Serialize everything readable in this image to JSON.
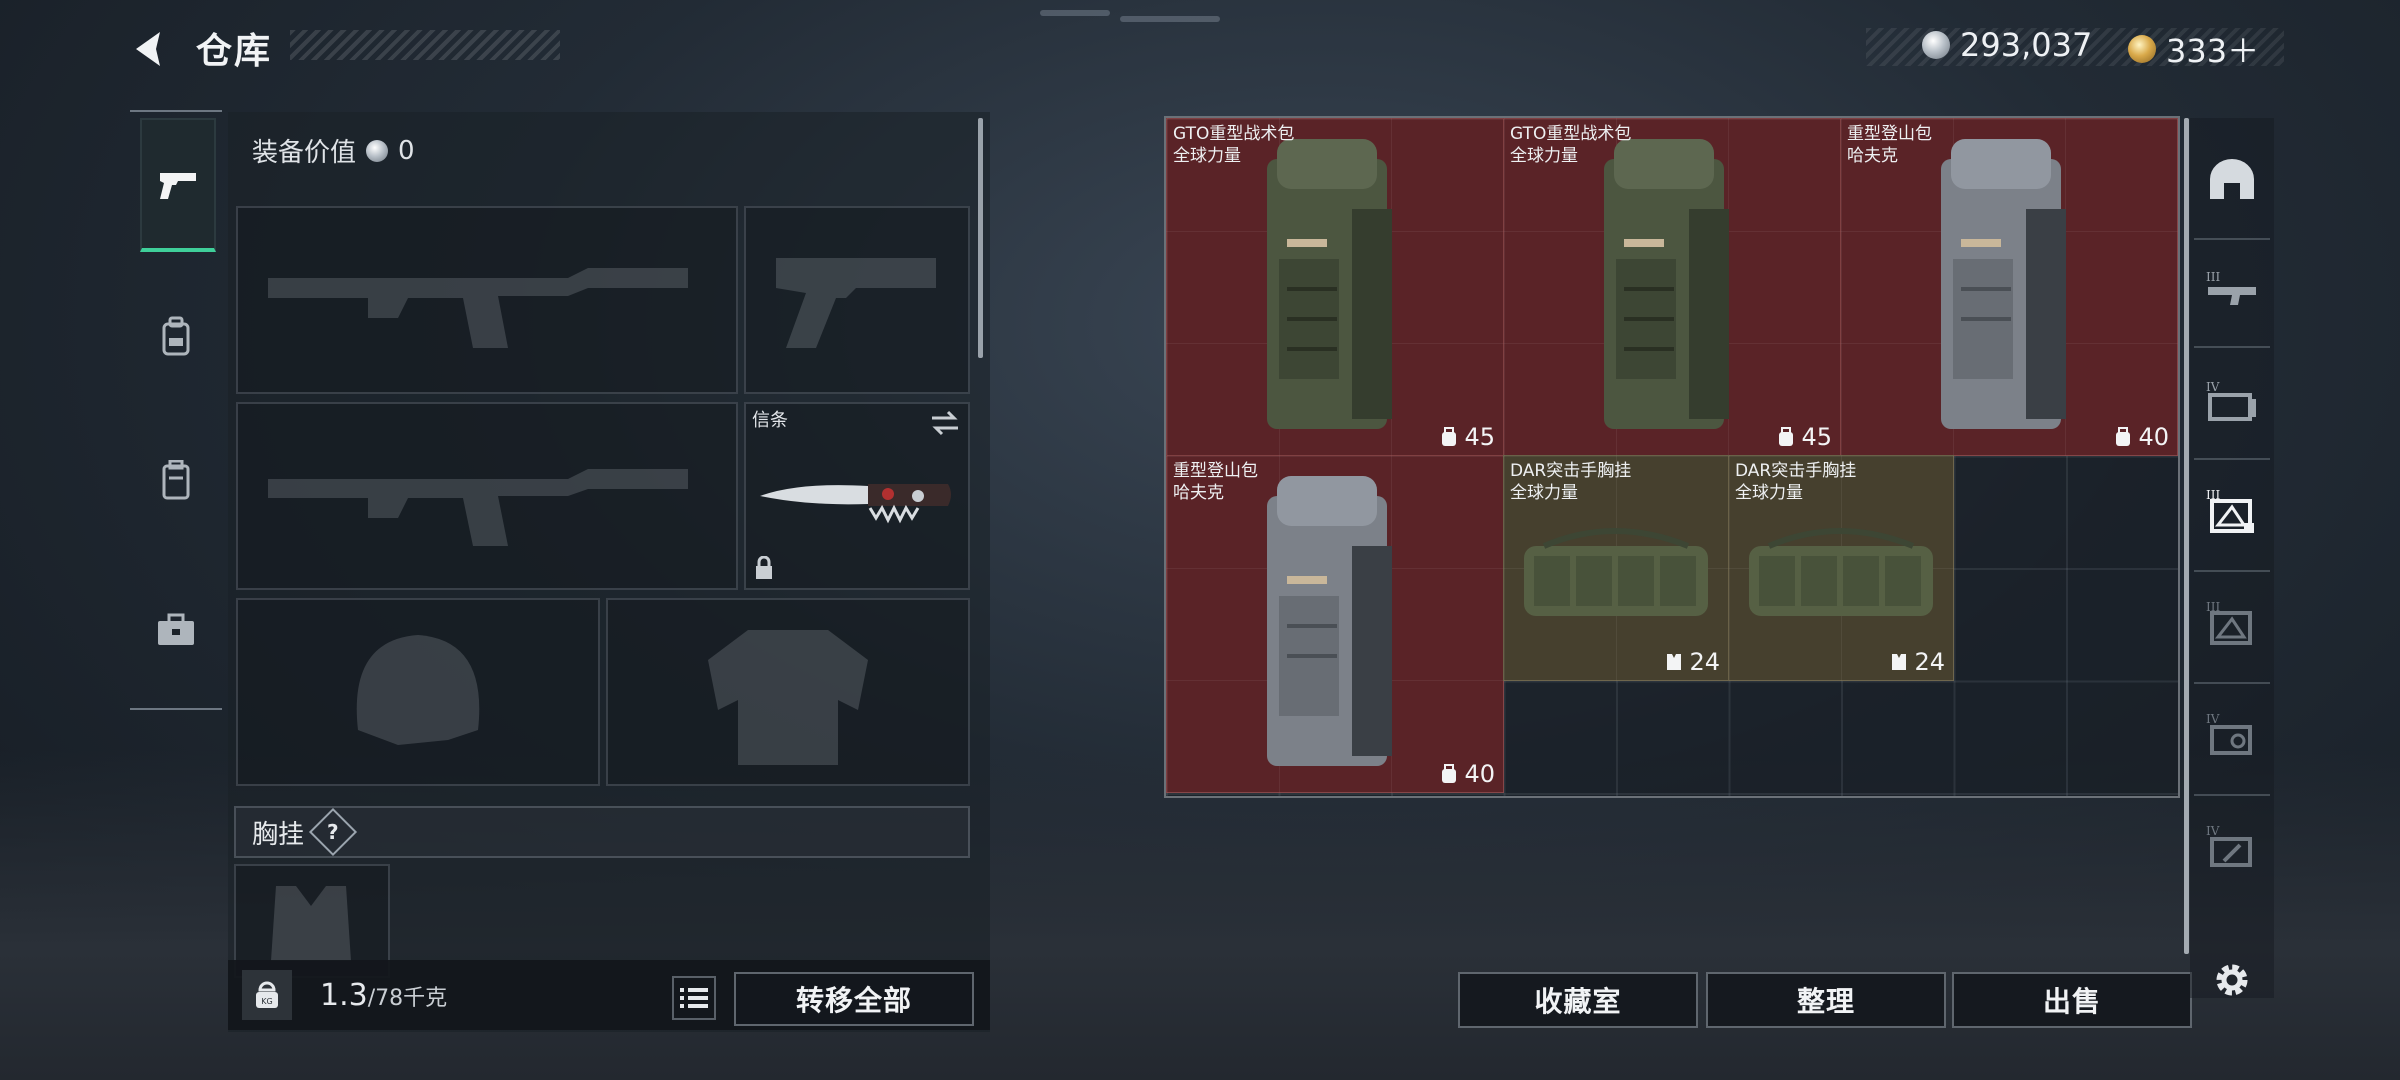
{
  "header": {
    "title": "仓库",
    "currency_silver": "293,037",
    "currency_gold": "333＋"
  },
  "loadout": {
    "equip_value_label": "装备价值",
    "equip_value": "0",
    "melee_slot_name": "信条",
    "chest_rig_section": "胸挂",
    "help_mark": "?"
  },
  "weight": {
    "current": "1.3",
    "max": "/78千克",
    "kg_badge": "KG"
  },
  "buttons": {
    "transfer_all": "转移全部",
    "collection": "收藏室",
    "sort": "整理",
    "sell": "出售"
  },
  "storage": {
    "items": [
      {
        "line1": "GTO重型战术包",
        "line2": "全球力量",
        "stat": "45",
        "stat_icon": "backpack-capacity-icon",
        "rarity_color": "#5a2327"
      },
      {
        "line1": "GTO重型战术包",
        "line2": "全球力量",
        "stat": "45",
        "stat_icon": "backpack-capacity-icon",
        "rarity_color": "#5a2327"
      },
      {
        "line1": "重型登山包",
        "line2": "哈夫克",
        "stat": "40",
        "stat_icon": "backpack-capacity-icon",
        "rarity_color": "#5a2327"
      },
      {
        "line1": "重型登山包",
        "line2": "哈夫克",
        "stat": "40",
        "stat_icon": "backpack-capacity-icon",
        "rarity_color": "#5a2327"
      },
      {
        "line1": "DAR突击手胸挂",
        "line2": "全球力量",
        "stat": "24",
        "stat_icon": "chest-rig-capacity-icon",
        "rarity_color": "#46402e"
      },
      {
        "line1": "DAR突击手胸挂",
        "line2": "全球力量",
        "stat": "24",
        "stat_icon": "chest-rig-capacity-icon",
        "rarity_color": "#46402e"
      }
    ]
  },
  "side_tabs_left": [
    "pistol-icon",
    "backpack-icon",
    "chest-rig-icon",
    "toolbox-icon"
  ],
  "side_tabs_right": [
    {
      "icon": "helmet-icon"
    },
    {
      "icon": "weapon-tier-icon",
      "tier": "III"
    },
    {
      "icon": "case-tier-icon",
      "tier": "IV"
    },
    {
      "icon": "storage-tier-icon",
      "tier": "III"
    },
    {
      "icon": "storage-tier-icon",
      "tier": "III"
    },
    {
      "icon": "key-tier-icon",
      "tier": "IV"
    },
    {
      "icon": "tool-tier-icon",
      "tier": "IV"
    }
  ]
}
